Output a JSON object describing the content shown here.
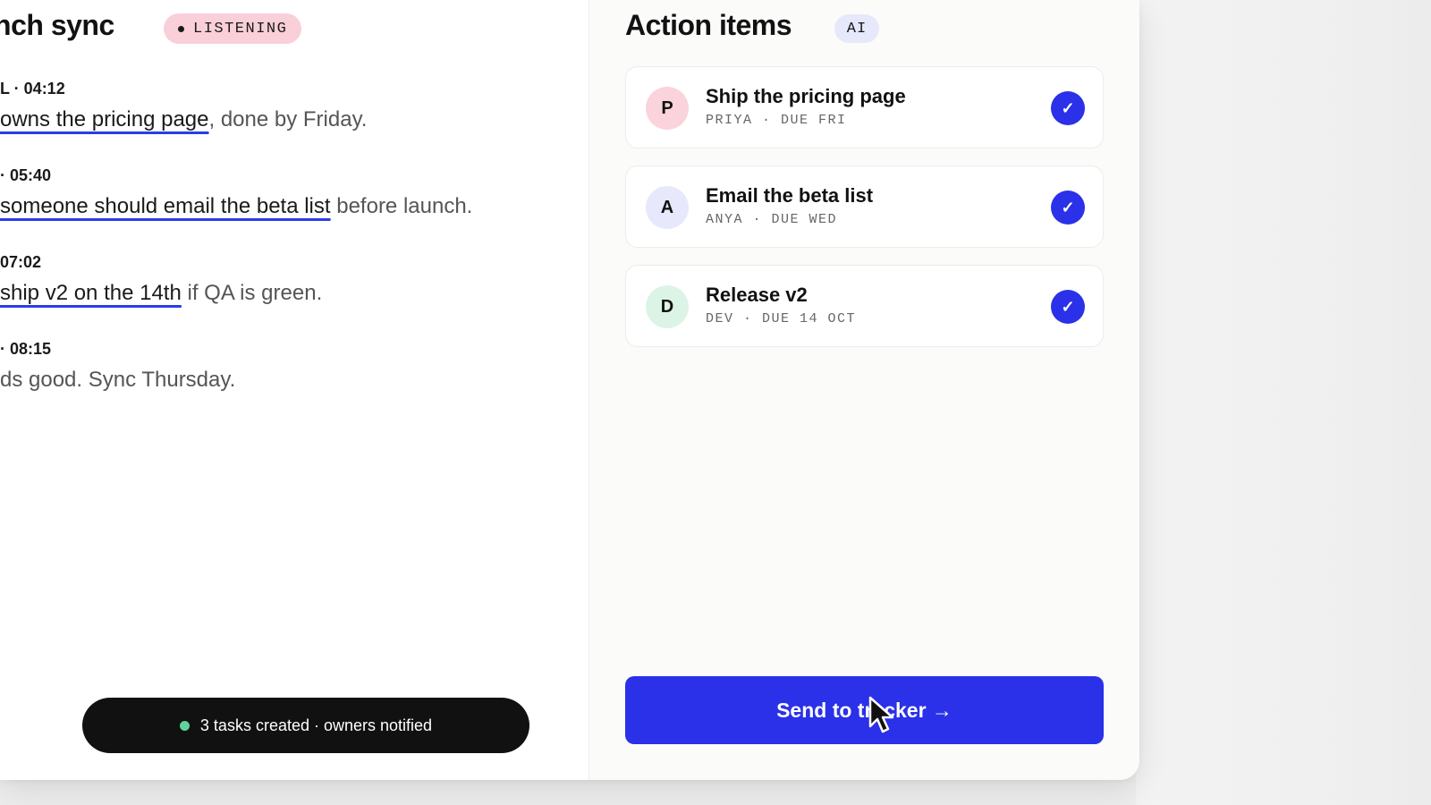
{
  "meeting": {
    "title": "unch sync",
    "status_badge": "LISTENING"
  },
  "transcript": [
    {
      "meta": "L · 04:12",
      "highlight": "owns the pricing page",
      "rest": ", done by Friday."
    },
    {
      "meta": "· 05:40",
      "highlight": "someone should email the beta list",
      "rest": " before launch."
    },
    {
      "meta": "07:02",
      "highlight": "ship v2 on the 14th",
      "rest": " if QA is green."
    },
    {
      "meta": "· 08:15",
      "highlight": "",
      "rest": "ds good. Sync Thursday."
    }
  ],
  "toast": {
    "text": "3 tasks created · owners notified"
  },
  "action_panel": {
    "title": "Action items",
    "badge": "AI",
    "items": [
      {
        "avatar": "P",
        "title": "Ship the pricing page",
        "subtitle": "PRIYA · DUE FRI",
        "checked": true
      },
      {
        "avatar": "A",
        "title": "Email the beta list",
        "subtitle": "ANYA · DUE WED",
        "checked": true
      },
      {
        "avatar": "D",
        "title": "Release v2",
        "subtitle": "DEV · DUE 14 OCT",
        "checked": true
      }
    ],
    "check_glyph": "✓",
    "send_button": "Send to tracker →"
  },
  "colors": {
    "accent": "#2a31e8",
    "listening_badge_bg": "#f9cfd9",
    "ai_badge_bg": "#e6e8fb",
    "toast_dot": "#5fd39a",
    "avatar_p_bg": "#fbd3dc",
    "avatar_a_bg": "#e7e8fb",
    "avatar_d_bg": "#dcf4e5"
  }
}
